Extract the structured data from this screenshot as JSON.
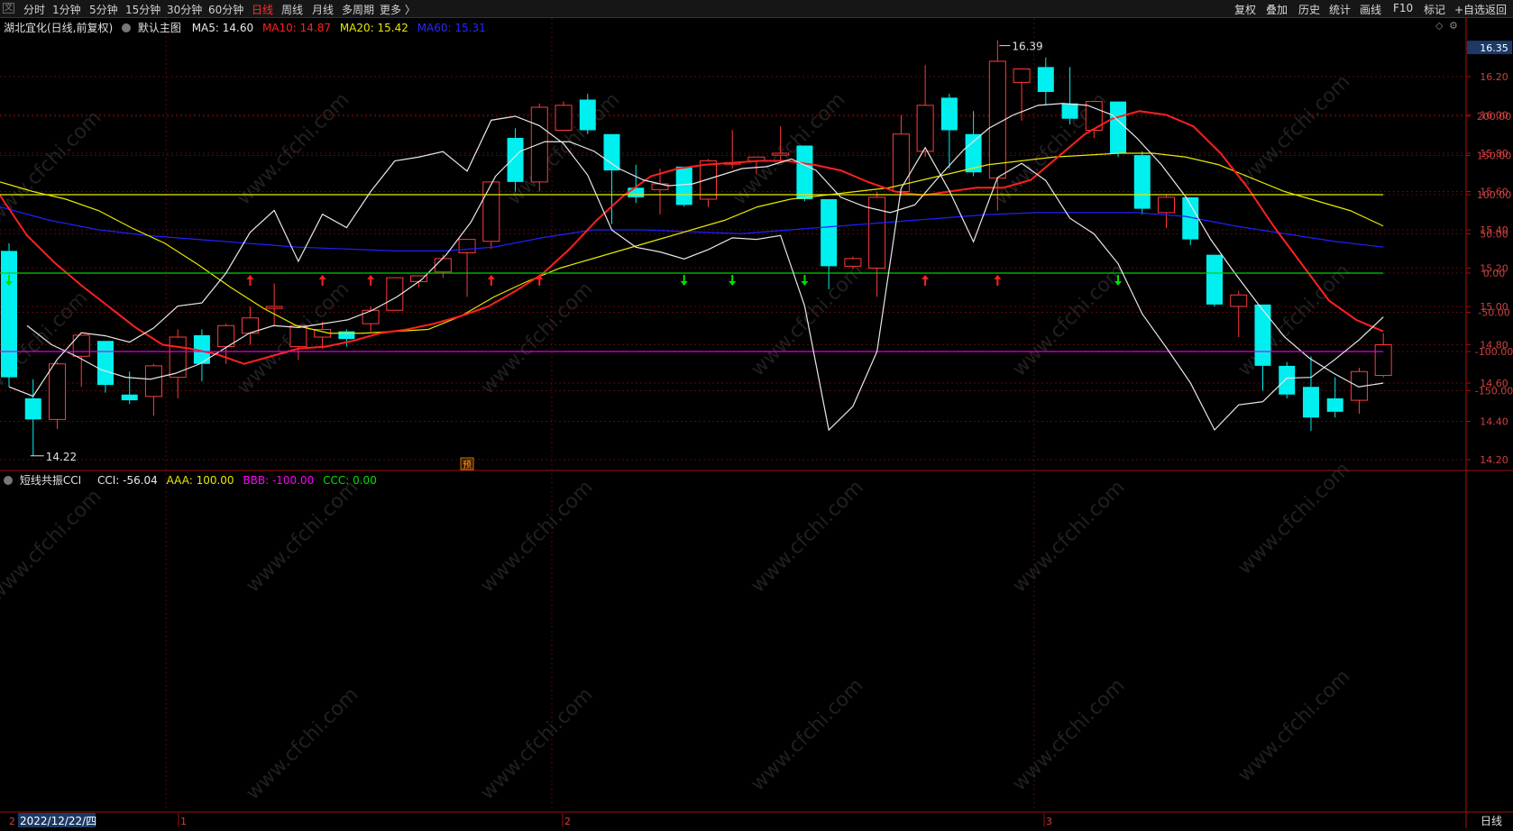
{
  "toolbar": {
    "menu_glyph": "文",
    "periods": [
      "分时",
      "1分钟",
      "5分钟",
      "15分钟",
      "30分钟",
      "60分钟",
      "日线",
      "周线",
      "月线",
      "多周期",
      "更多 〉"
    ],
    "active_period": "日线",
    "right_actions": [
      "复权",
      "叠加",
      "历史",
      "统计",
      "画线",
      "F10",
      "标记",
      "+自选",
      "返回"
    ]
  },
  "main_panel": {
    "stock_title": "湖北宜化(日线,前复权)",
    "template": "默认主图",
    "ma5": "MA5: 14.60",
    "ma10": "MA10: 14.87",
    "ma20": "MA20: 15.42",
    "ma60": "MA60: 15.31",
    "high_label": "16.39",
    "low_label": "14.22",
    "pre_badge": "预",
    "price_axis": [
      "16.35",
      "16.20",
      "16.00",
      "15.80",
      "15.60",
      "15.40",
      "15.20",
      "15.00",
      "14.80",
      "14.60",
      "14.40",
      "14.20"
    ]
  },
  "sub_panel": {
    "name": "短线共振CCI",
    "cci": "CCI: -56.04",
    "aaa": "AAA: 100.00",
    "bbb": "BBB: -100.00",
    "ccc": "CCC: 0.00",
    "axis": [
      "200.00",
      "150.00",
      "100.00",
      "50.00",
      "0.00",
      "-50.00",
      "-100.00",
      "-150.00"
    ]
  },
  "bottom": {
    "date": "2022/12/22/四",
    "month_markers": [
      "1",
      "2",
      "3"
    ],
    "period_label": "日线"
  },
  "watermark": "www.cfchi.com",
  "colors": {
    "up": "#ff3b3b",
    "down": "#00f0f0",
    "ma5": "#e8e8e8",
    "ma10": "#ff2020",
    "ma20": "#e8e800",
    "ma60": "#2020ff",
    "bbb": "#ff00ff",
    "ccc": "#00e000"
  },
  "chart_data": {
    "type": "candlestick",
    "candles": [
      {
        "o": 15.29,
        "h": 15.33,
        "c": 14.63,
        "l": 14.58
      },
      {
        "o": 14.52,
        "h": 14.62,
        "c": 14.41,
        "l": 14.22
      },
      {
        "o": 14.41,
        "h": 14.71,
        "c": 14.7,
        "l": 14.36
      },
      {
        "o": 14.74,
        "h": 14.85,
        "c": 14.85,
        "l": 14.58
      },
      {
        "o": 14.82,
        "h": 14.82,
        "c": 14.59,
        "l": 14.55
      },
      {
        "o": 14.54,
        "h": 14.66,
        "c": 14.51,
        "l": 14.49
      },
      {
        "o": 14.53,
        "h": 14.7,
        "c": 14.69,
        "l": 14.43
      },
      {
        "o": 14.63,
        "h": 14.88,
        "c": 14.84,
        "l": 14.52
      },
      {
        "o": 14.85,
        "h": 14.88,
        "c": 14.7,
        "l": 14.61
      },
      {
        "o": 14.79,
        "h": 14.91,
        "c": 14.9,
        "l": 14.7
      },
      {
        "o": 14.86,
        "h": 15.0,
        "c": 14.94,
        "l": 14.8
      },
      {
        "o": 14.99,
        "h": 15.12,
        "c": 15.0,
        "l": 14.9
      },
      {
        "o": 14.79,
        "h": 14.9,
        "c": 14.9,
        "l": 14.72
      },
      {
        "o": 14.84,
        "h": 14.92,
        "c": 14.88,
        "l": 14.78
      },
      {
        "o": 14.87,
        "h": 14.88,
        "c": 14.83,
        "l": 14.79
      },
      {
        "o": 14.91,
        "h": 15.0,
        "c": 14.98,
        "l": 14.87
      },
      {
        "o": 14.98,
        "h": 15.15,
        "c": 15.15,
        "l": 14.98
      },
      {
        "o": 15.13,
        "h": 15.16,
        "c": 15.16,
        "l": 15.1
      },
      {
        "o": 15.18,
        "h": 15.27,
        "c": 15.25,
        "l": 15.15
      },
      {
        "o": 15.28,
        "h": 15.35,
        "c": 15.35,
        "l": 15.05
      },
      {
        "o": 15.34,
        "h": 15.65,
        "c": 15.65,
        "l": 15.3
      },
      {
        "o": 15.88,
        "h": 15.93,
        "c": 15.65,
        "l": 15.6
      },
      {
        "o": 15.65,
        "h": 16.06,
        "c": 16.04,
        "l": 15.6
      },
      {
        "o": 15.92,
        "h": 16.07,
        "c": 16.05,
        "l": 15.92
      },
      {
        "o": 16.08,
        "h": 16.11,
        "c": 15.92,
        "l": 15.9
      },
      {
        "o": 15.9,
        "h": 15.9,
        "c": 15.71,
        "l": 15.43
      },
      {
        "o": 15.62,
        "h": 15.74,
        "c": 15.57,
        "l": 15.54
      },
      {
        "o": 15.61,
        "h": 15.72,
        "c": 15.64,
        "l": 15.48
      },
      {
        "o": 15.73,
        "h": 15.73,
        "c": 15.53,
        "l": 15.52
      },
      {
        "o": 15.56,
        "h": 15.77,
        "c": 15.76,
        "l": 15.52
      },
      {
        "o": 15.75,
        "h": 15.92,
        "c": 15.75,
        "l": 15.72
      },
      {
        "o": 15.76,
        "h": 15.77,
        "c": 15.78,
        "l": 15.69
      },
      {
        "o": 15.79,
        "h": 15.94,
        "c": 15.8,
        "l": 15.75
      },
      {
        "o": 15.84,
        "h": 15.84,
        "c": 15.56,
        "l": 15.55
      },
      {
        "o": 15.56,
        "h": 15.56,
        "c": 15.21,
        "l": 15.09
      },
      {
        "o": 15.21,
        "h": 15.26,
        "c": 15.25,
        "l": 15.2
      },
      {
        "o": 15.2,
        "h": 15.6,
        "c": 15.57,
        "l": 15.05
      },
      {
        "o": 15.6,
        "h": 16.0,
        "c": 15.9,
        "l": 15.58
      },
      {
        "o": 15.81,
        "h": 16.26,
        "c": 16.05,
        "l": 15.78
      },
      {
        "o": 16.09,
        "h": 16.11,
        "c": 15.92,
        "l": 15.72
      },
      {
        "o": 15.9,
        "h": 16.02,
        "c": 15.7,
        "l": 15.68
      },
      {
        "o": 15.67,
        "h": 16.39,
        "c": 16.28,
        "l": 15.5
      },
      {
        "o": 16.17,
        "h": 16.24,
        "c": 16.24,
        "l": 15.97
      },
      {
        "o": 16.25,
        "h": 16.3,
        "c": 16.12,
        "l": 16.05
      },
      {
        "o": 16.06,
        "h": 16.25,
        "c": 15.98,
        "l": 15.95
      },
      {
        "o": 15.92,
        "h": 16.07,
        "c": 16.07,
        "l": 15.88
      },
      {
        "o": 16.07,
        "h": 16.07,
        "c": 15.8,
        "l": 15.78
      },
      {
        "o": 15.79,
        "h": 15.81,
        "c": 15.51,
        "l": 15.48
      },
      {
        "o": 15.49,
        "h": 15.58,
        "c": 15.57,
        "l": 15.41
      },
      {
        "o": 15.57,
        "h": 15.57,
        "c": 15.35,
        "l": 15.32
      },
      {
        "o": 15.27,
        "h": 15.27,
        "c": 15.01,
        "l": 15.0
      },
      {
        "o": 15.0,
        "h": 15.08,
        "c": 15.06,
        "l": 14.84
      },
      {
        "o": 15.01,
        "h": 15.01,
        "c": 14.69,
        "l": 14.56
      },
      {
        "o": 14.69,
        "h": 14.71,
        "c": 14.54,
        "l": 14.52
      },
      {
        "o": 14.58,
        "h": 14.74,
        "c": 14.42,
        "l": 14.35
      },
      {
        "o": 14.52,
        "h": 14.63,
        "c": 14.45,
        "l": 14.42
      },
      {
        "o": 14.51,
        "h": 14.68,
        "c": 14.66,
        "l": 14.44
      },
      {
        "o": 14.64,
        "h": 14.86,
        "c": 14.8,
        "l": 14.63
      }
    ],
    "ma5": [
      14.9,
      14.8,
      14.74,
      14.67,
      14.63,
      14.62,
      14.65,
      14.7,
      14.78,
      14.86,
      14.9,
      14.89,
      14.91,
      14.93,
      14.98,
      15.05,
      15.14,
      15.27,
      15.44,
      15.68,
      15.81,
      15.86,
      15.86,
      15.81,
      15.72,
      15.66,
      15.63,
      15.64,
      15.68,
      15.72,
      15.73,
      15.77,
      15.71,
      15.57,
      15.52,
      15.49,
      15.53,
      15.68,
      15.82,
      15.93,
      16.0,
      16.05,
      16.06,
      16.05,
      16.0,
      15.88,
      15.74,
      15.57,
      15.35,
      15.17,
      15.0,
      14.84,
      14.73,
      14.65,
      14.58,
      14.6
    ],
    "ma10": [
      15.58,
      15.37,
      15.23,
      15.11,
      15.0,
      14.89,
      14.8,
      14.78,
      14.75,
      14.7,
      14.74,
      14.78,
      14.79,
      14.82,
      14.86,
      14.88,
      14.91,
      14.95,
      15.0,
      15.08,
      15.17,
      15.3,
      15.45,
      15.58,
      15.68,
      15.72,
      15.74,
      15.75,
      15.76,
      15.76,
      15.74,
      15.71,
      15.65,
      15.6,
      15.58,
      15.6,
      15.62,
      15.62,
      15.66,
      15.78,
      15.9,
      15.98,
      16.02,
      16.0,
      15.94,
      15.8,
      15.62,
      15.41,
      15.22,
      15.03,
      14.93,
      14.87
    ],
    "ma20": [
      15.65,
      15.6,
      15.56,
      15.5,
      15.41,
      15.33,
      15.22,
      15.1,
      14.99,
      14.9,
      14.86,
      14.86,
      14.87,
      14.88,
      14.95,
      15.05,
      15.13,
      15.2,
      15.25,
      15.3,
      15.35,
      15.4,
      15.45,
      15.52,
      15.56,
      15.58,
      15.6,
      15.62,
      15.66,
      15.7,
      15.74,
      15.76,
      15.78,
      15.79,
      15.8,
      15.8,
      15.78,
      15.74,
      15.67,
      15.6,
      15.55,
      15.5,
      15.42
    ],
    "ma60": [
      15.52,
      15.45,
      15.4,
      15.37,
      15.35,
      15.33,
      15.31,
      15.3,
      15.29,
      15.29,
      15.31,
      15.36,
      15.4,
      15.4,
      15.39,
      15.38,
      15.4,
      15.42,
      15.44,
      15.46,
      15.48,
      15.49,
      15.49,
      15.49,
      15.47,
      15.42,
      15.38,
      15.34,
      15.31
    ],
    "cci": [
      -145,
      -157,
      -110,
      -76,
      -80,
      -88,
      -70,
      -42,
      -38,
      0,
      52,
      80,
      15,
      75,
      58,
      104,
      143,
      148,
      155,
      130,
      195,
      200,
      188,
      165,
      125,
      55,
      33,
      27,
      18,
      30,
      45,
      43,
      48,
      -42,
      -200,
      -170,
      -100,
      108,
      160,
      105,
      40,
      122,
      140,
      118,
      70,
      50,
      12,
      -52,
      -95,
      -140,
      -200,
      -168,
      -164,
      -134,
      -133,
      -110,
      -85,
      -56
    ],
    "aaa": 100,
    "bbb": -100,
    "ccc": 0,
    "up_arrows": [
      10,
      13,
      15,
      20,
      22,
      38,
      41
    ],
    "down_arrows": [
      0,
      28,
      30,
      33,
      46
    ]
  }
}
